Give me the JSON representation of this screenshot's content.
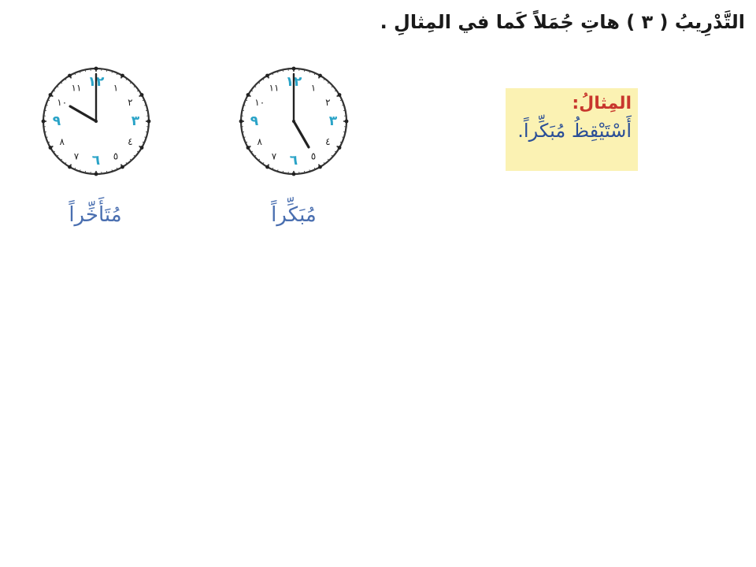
{
  "page": {
    "title": "التَّدْرِيبُ ( ٣ ) هاتِ جُمَلاً كَما في المِثالِ ."
  },
  "example": {
    "label": "المِثالُ:",
    "sentence": "أَسْتَيْقِظُ مُبَكِّراً."
  },
  "clocks": [
    {
      "id": "clock-early",
      "caption": "مُبَكِّراً",
      "time": "5:00",
      "hour": 5,
      "minute": 0
    },
    {
      "id": "clock-late",
      "caption": "مُتَأَخِّراً",
      "time": "10:00",
      "hour": 10,
      "minute": 0
    }
  ],
  "clock_face": {
    "numerals": [
      "١٢",
      "١",
      "٢",
      "٣",
      "٤",
      "٥",
      "٦",
      "٧",
      "٨",
      "٩",
      "١٠",
      "١١"
    ],
    "highlight_numerals": [
      "١٢",
      "٣",
      "٦",
      "٩"
    ],
    "highlight_color": "#2aa3c7",
    "numeral_color": "#222222"
  },
  "colors": {
    "example_background": "#fbf2b3",
    "example_label": "#c8372d",
    "example_sentence": "#2b4f97",
    "caption": "#4a6fb0"
  }
}
